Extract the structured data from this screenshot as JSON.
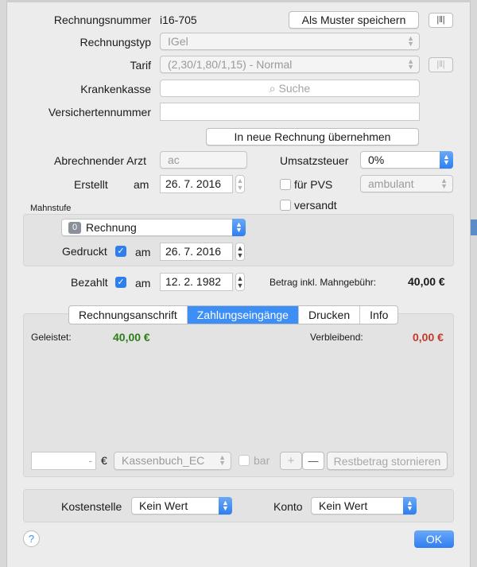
{
  "form": {
    "rechnungsnummer_label": "Rechnungsnummer",
    "rechnungsnummer_value": "i16-705",
    "als_muster_button": "Als Muster speichern",
    "rechnungstyp_label": "Rechnungstyp",
    "rechnungstyp_value": "IGel",
    "tarif_label": "Tarif",
    "tarif_value": "(2,30/1,80/1,15)  -  Normal",
    "krankenkasse_label": "Krankenkasse",
    "krankenkasse_placeholder": "Suche",
    "versichertennummer_label": "Versichertennummer",
    "uebernehmen_button": "In neue Rechnung übernehmen",
    "arzt_label": "Abrechnender Arzt",
    "arzt_value": "ac",
    "umsatzsteuer_label": "Umsatzsteuer",
    "umsatzsteuer_value": "0%",
    "erstellt_label": "Erstellt",
    "erstellt_am": "am",
    "erstellt_date": "26.  7. 2016",
    "fuer_pvs_label": "für PVS",
    "ambulant_value": "ambulant",
    "versandt_label": "versandt",
    "mahnstufe_label": "Mahnstufe",
    "mahnstufe_value": "Rechnung",
    "mahnstufe_badge": "0",
    "gedruckt_label": "Gedruckt",
    "gedruckt_am": "am",
    "gedruckt_date": "26.  7. 2016",
    "bezahlt_label": "Bezahlt",
    "bezahlt_am": "am",
    "bezahlt_date": "12.  2. 1982",
    "betrag_label": "Betrag inkl. Mahngebühr:",
    "betrag_value": "40,00 €"
  },
  "tabs": [
    "Rechnungsanschrift",
    "Zahlungseingänge",
    "Drucken",
    "Info"
  ],
  "active_tab": 1,
  "payments": {
    "geleistet_label": "Geleistet:",
    "geleistet_value": "40,00 €",
    "verbleibend_label": "Verbleibend:",
    "verbleibend_value": "0,00 €",
    "amount_placeholder": "-",
    "currency": "€",
    "kasse_value": "Kassenbuch_EC",
    "bar_label": "bar",
    "plus": "+",
    "minus": "—",
    "storno_button": "Restbetrag stornieren"
  },
  "footer": {
    "kostenstelle_label": "Kostenstelle",
    "kostenstelle_value": "Kein Wert",
    "konto_label": "Konto",
    "konto_value": "Kein Wert",
    "help": "?",
    "ok_button": "OK"
  },
  "colors": {
    "green": "#2f7d18",
    "red": "#c0392b",
    "accent": "#3d8ef5"
  }
}
